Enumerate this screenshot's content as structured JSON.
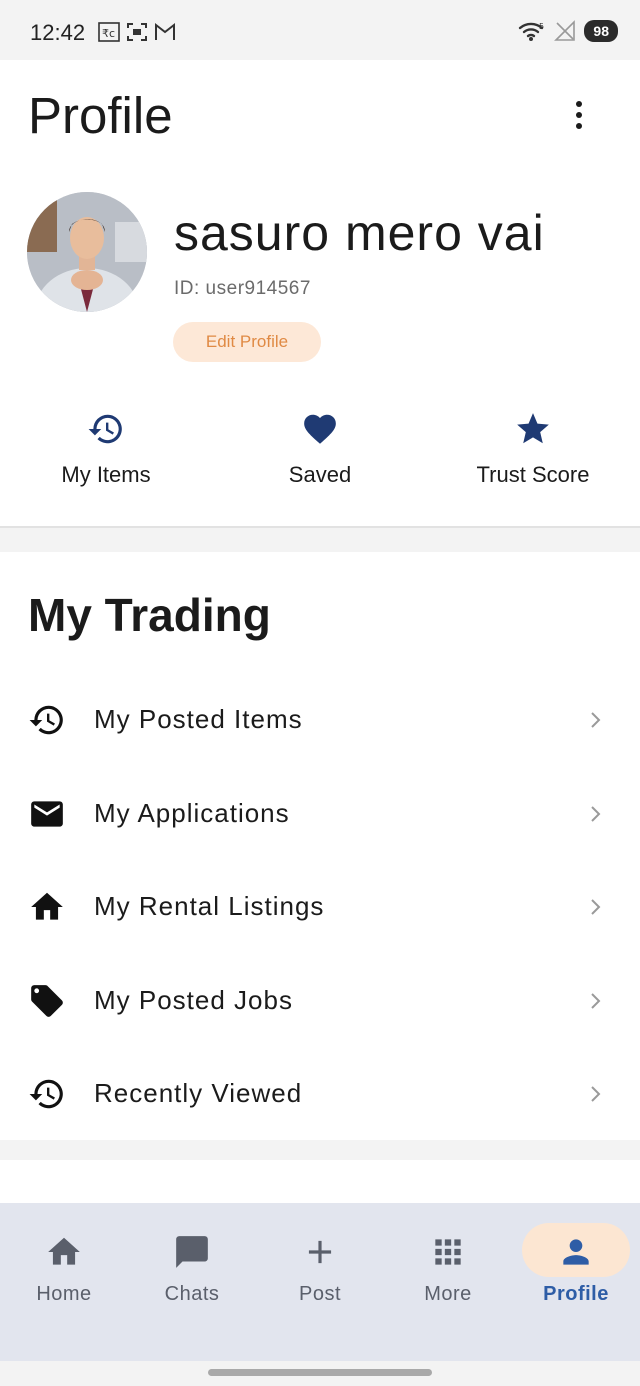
{
  "status_bar": {
    "time": "12:42",
    "left_icons": [
      "rupee-icon",
      "screen-capture-icon",
      "gmail-icon"
    ],
    "right_icons": [
      "wifi-icon",
      "no-signal-icon"
    ],
    "battery": "98"
  },
  "header": {
    "title": "Profile",
    "menu_icon": "more-vert-icon"
  },
  "profile": {
    "name": "sasuro mero vai",
    "user_id": "ID: user914567",
    "edit_label": "Edit Profile"
  },
  "quick_actions": [
    {
      "label": "My Items",
      "icon": "history-icon"
    },
    {
      "label": "Saved",
      "icon": "heart-icon"
    },
    {
      "label": "Trust Score",
      "icon": "star-icon"
    }
  ],
  "trading": {
    "title": "My Trading",
    "items": [
      {
        "label": "My Posted Items",
        "icon": "history-icon"
      },
      {
        "label": "My Applications",
        "icon": "mail-icon"
      },
      {
        "label": "My Rental Listings",
        "icon": "home-icon"
      },
      {
        "label": "My Posted Jobs",
        "icon": "tag-icon"
      },
      {
        "label": "Recently Viewed",
        "icon": "history-icon"
      }
    ]
  },
  "bottom_nav": {
    "items": [
      {
        "label": "Home",
        "icon": "home-icon"
      },
      {
        "label": "Chats",
        "icon": "chat-icon"
      },
      {
        "label": "Post",
        "icon": "plus-icon"
      },
      {
        "label": "More",
        "icon": "grid-icon"
      },
      {
        "label": "Profile",
        "icon": "person-icon",
        "active": true
      }
    ],
    "active_color": "#2e5da6",
    "active_pill_color": "#fce6d2"
  },
  "colors": {
    "accent_navy": "#1f3a73",
    "edit_bg": "#fde8d7",
    "edit_text": "#e08a44"
  }
}
